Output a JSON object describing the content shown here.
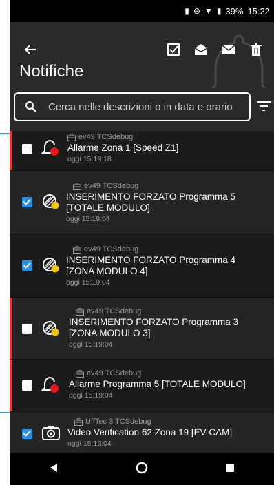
{
  "status": {
    "battery": "39%",
    "time": "15:22"
  },
  "header": {
    "title": "Notifiche"
  },
  "search": {
    "placeholder": "Cerca nelle descrizioni o in data e orario"
  },
  "notifications": [
    {
      "device": "ev49 TCSdebug",
      "description": "Allarme Zona 1 [Speed Z1]",
      "time": "oggi 15:19:18",
      "checked": false,
      "icon": "bell-alarm-icon",
      "alarm": true
    },
    {
      "device": "ev49 TCSdebug",
      "description": "INSERIMENTO FORZATO Programma 5 [TOTALE MODULO]",
      "time": "oggi 15:19:04",
      "checked": true,
      "icon": "forced-arming-icon",
      "alarm": false
    },
    {
      "device": "ev49 TCSdebug",
      "description": "INSERIMENTO FORZATO Programma 4 [ZONA MODULO 4]",
      "time": "oggi 15:19:04",
      "checked": true,
      "icon": "forced-arming-icon",
      "alarm": false
    },
    {
      "device": "ev49 TCSdebug",
      "description": "INSERIMENTO FORZATO Programma 3 [ZONA MODULO 3]",
      "time": "oggi 15:19:04",
      "checked": false,
      "icon": "forced-arming-icon",
      "alarm": true
    },
    {
      "device": "ev49 TCSdebug",
      "description": "Allarme Programma 5 [TOTALE MODULO]",
      "time": "oggi 15:19:04",
      "checked": false,
      "icon": "bell-alarm-icon",
      "alarm": true
    },
    {
      "device": "UffTec 3 TCSdebug",
      "description": "Video Verification 62 Zona 19 [EV-CAM]",
      "time": "oggi 15:19:04",
      "checked": true,
      "icon": "camera-icon",
      "alarm": false
    }
  ]
}
